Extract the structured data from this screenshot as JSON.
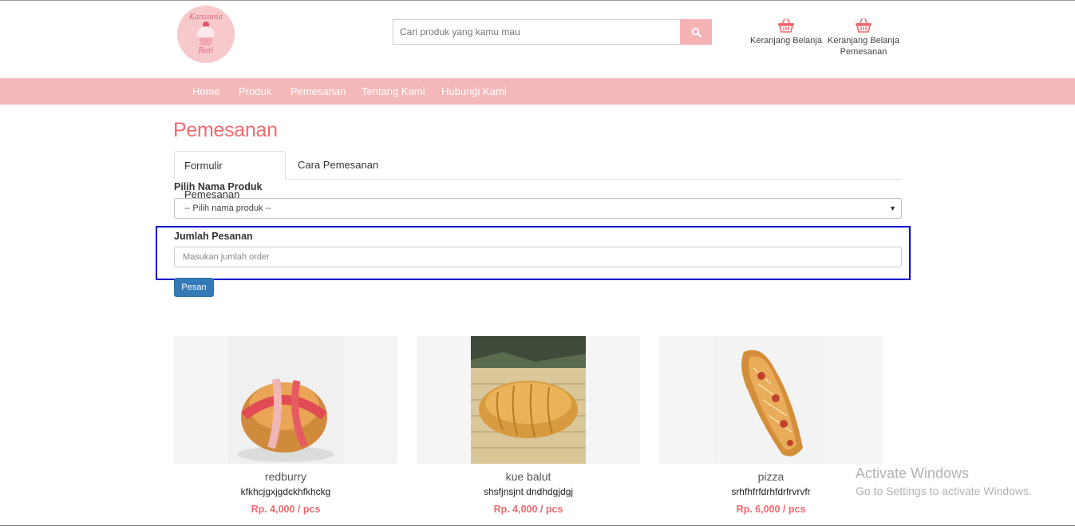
{
  "header": {
    "logo": {
      "line1": "Kanzania",
      "line2": "Roti"
    },
    "search": {
      "placeholder": "Cari produk yang kamu mau"
    },
    "cart_basket": {
      "label": "Keranjang Belanja"
    },
    "cart_order": {
      "label_line1": "Keranjang Belanja",
      "label_line2": "Pemesanan"
    }
  },
  "nav": {
    "items": [
      {
        "label": "Home"
      },
      {
        "label": "Produk"
      },
      {
        "label": "Pemesanan"
      },
      {
        "label": "Tentang Kami"
      },
      {
        "label": "Hubungi Kami"
      }
    ]
  },
  "main": {
    "title": "Pemesanan",
    "tabs": [
      {
        "label": "Formulir Pemesanan",
        "active": true
      },
      {
        "label": "Cara Pemesanan",
        "active": false
      }
    ],
    "form": {
      "product_label": "Pilih Nama Produk",
      "product_selected": "-- Pilih nama produk --",
      "qty_label": "Jumlah Pesanan",
      "qty_placeholder": "Masukan jumlah order",
      "submit_label": "Pesan"
    },
    "products": [
      {
        "name": "redburry",
        "description": "kfkhcjgxjgdckhfkhckg",
        "price": "Rp. 4,000 / pcs"
      },
      {
        "name": "kue balut",
        "description": "shsfjnsjnt dndhdgjdgj",
        "price": "Rp. 4,000 / pcs"
      },
      {
        "name": "pizza",
        "description": "srhfhfrfdrhfdrfrvrvfr",
        "price": "Rp. 6,000 / pcs"
      }
    ]
  },
  "watermark": {
    "title": "Activate Windows",
    "subtitle": "Go to Settings to activate Windows."
  },
  "colors": {
    "accent_pink": "#f5b8b9",
    "title_red": "#f06a6f",
    "button_blue": "#337ab7",
    "highlight_blue": "#0000cc"
  }
}
